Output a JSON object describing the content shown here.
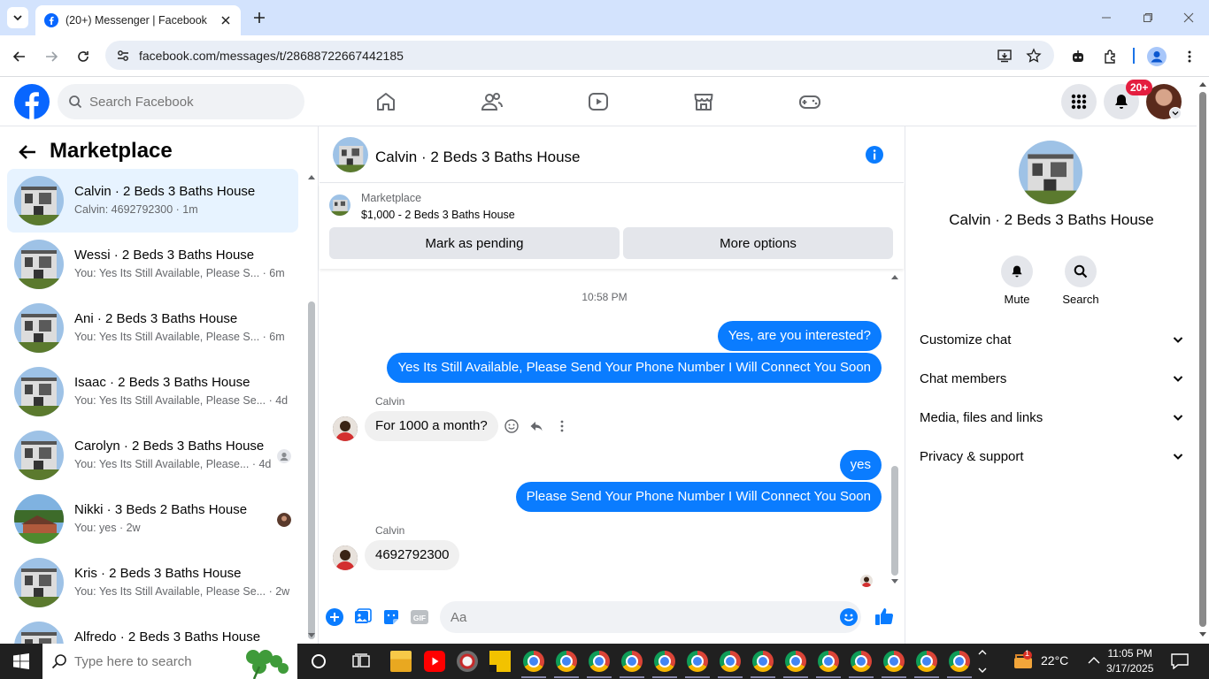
{
  "browser": {
    "tab_title": "(20+) Messenger | Facebook",
    "url": "facebook.com/messages/t/28688722667442185"
  },
  "fb_header": {
    "search_placeholder": "Search Facebook",
    "notification_badge": "20+",
    "brand_color": "#0866ff"
  },
  "left_panel": {
    "title": "Marketplace",
    "conversations": [
      {
        "name": "Calvin · 2 Beds 3 Baths House",
        "preview": "Calvin: 4692792300 · 1m",
        "active": true
      },
      {
        "name": "Wessi · 2 Beds 3 Baths House",
        "preview": "You: Yes Its Still Available, Please S... · 6m"
      },
      {
        "name": "Ani · 2 Beds 3 Baths House",
        "preview": "You: Yes Its Still Available, Please S... · 6m"
      },
      {
        "name": "Isaac · 2 Beds 3 Baths House",
        "preview": "You: Yes Its Still Available, Please Se... · 4d"
      },
      {
        "name": "Carolyn · 2 Beds 3 Baths House",
        "preview": "You: Yes Its Still Available, Please... · 4d"
      },
      {
        "name": "Nikki · 3 Beds 2 Baths House",
        "preview": "You: yes · 2w"
      },
      {
        "name": "Kris · 2 Beds 3 Baths House",
        "preview": "You: Yes Its Still Available, Please Se... · 2w"
      },
      {
        "name": "Alfredo · 2 Beds 3 Baths House",
        "preview": ""
      }
    ]
  },
  "chat": {
    "title": "Calvin · 2 Beds 3 Baths House",
    "marketplace_label": "Marketplace",
    "listing": "$1,000 - 2 Beds 3 Baths House",
    "mark_pending": "Mark as pending",
    "more_options": "More options",
    "timestamp": "10:58 PM",
    "messages": {
      "m1": "Yes, are you interested?",
      "m2": "Yes Its Still Available, Please Send Your Phone Number I Will Connect You Soon",
      "sender1": "Calvin",
      "m3": "For 1000 a month?",
      "m4": "yes",
      "m5": "Please Send Your Phone Number I Will Connect You Soon",
      "sender2": "Calvin",
      "m6": "4692792300"
    },
    "composer_placeholder": "Aa",
    "outgoing_color": "#0a7cff"
  },
  "details": {
    "name": "Calvin · 2 Beds 3 Baths House",
    "mute": "Mute",
    "search": "Search",
    "sections": [
      "Customize chat",
      "Chat members",
      "Media, files and links",
      "Privacy & support"
    ]
  },
  "taskbar": {
    "search_placeholder": "Type here to search",
    "weather": "22°C",
    "weather_badge": "1",
    "time": "11:05 PM",
    "date": "3/17/2025"
  }
}
